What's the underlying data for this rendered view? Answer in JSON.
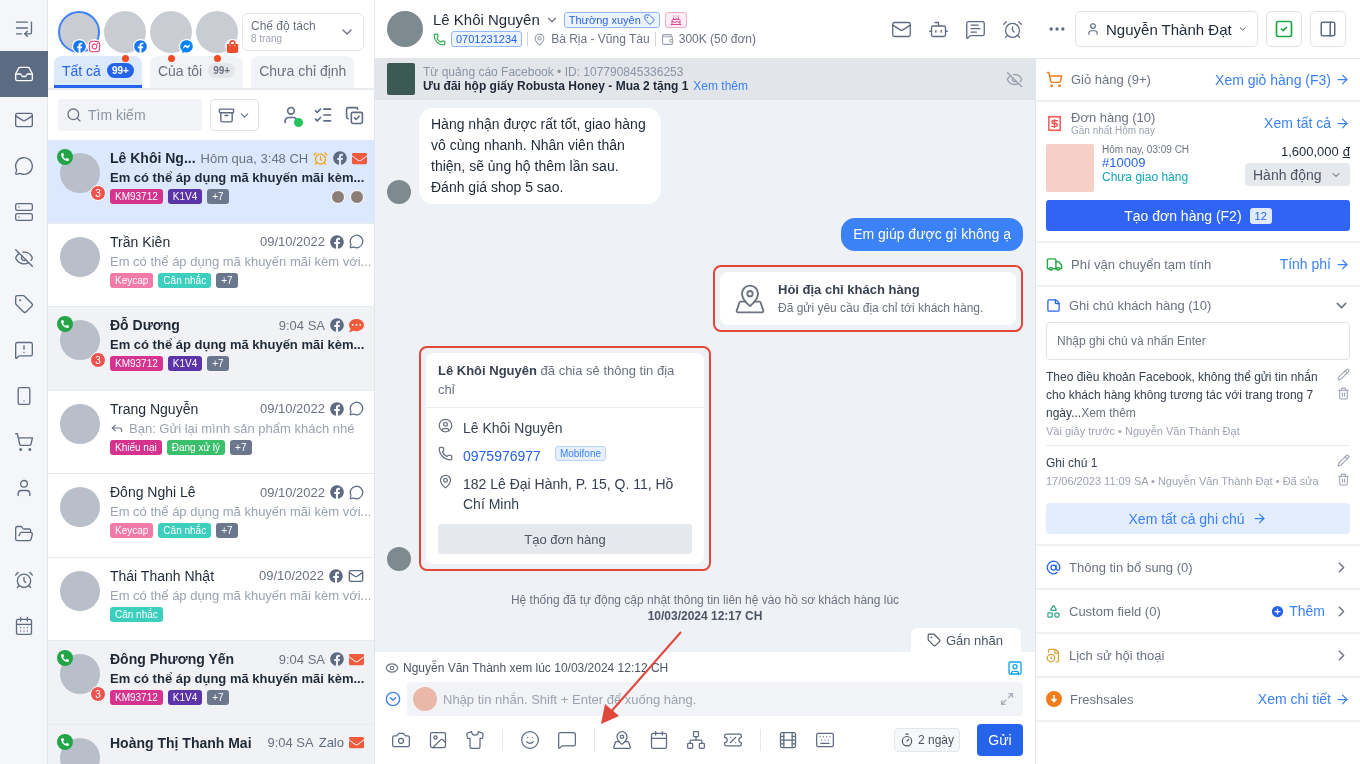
{
  "rail": {
    "items": [
      {
        "selected": false
      },
      {
        "selected": true
      },
      {
        "selected": false
      },
      {
        "selected": false
      },
      {
        "selected": false
      },
      {
        "selected": false
      },
      {
        "selected": false
      },
      {
        "selected": false
      },
      {
        "selected": false
      },
      {
        "selected": false
      },
      {
        "selected": false
      },
      {
        "selected": false
      },
      {
        "selected": false
      },
      {
        "selected": false
      }
    ]
  },
  "pages": [
    {
      "selected": true,
      "unread": false,
      "channels": [
        {
          "kind": "facebook"
        },
        {
          "kind": "instagram"
        }
      ]
    },
    {
      "selected": false,
      "unread": true,
      "channels": [
        {
          "kind": "facebook"
        }
      ]
    },
    {
      "selected": false,
      "unread": true,
      "channels": [
        {
          "kind": "messenger"
        }
      ]
    },
    {
      "selected": false,
      "unread": true,
      "channels": [
        {
          "kind": "shopee"
        }
      ]
    }
  ],
  "mode": {
    "title": "Chế độ tách",
    "subtitle": "8 trang"
  },
  "tabs": [
    {
      "label": "Tất cả",
      "count": "99+",
      "selected": true
    },
    {
      "label": "Của tôi",
      "count": "99+",
      "selected": false
    },
    {
      "label": "Chưa chỉ định",
      "selected": false
    }
  ],
  "search": {
    "placeholder": "Tìm kiếm"
  },
  "conversations": [
    {
      "name": "Lê Khôi Ng...",
      "time": "Hôm qua, 3:48 CH",
      "reminder": true,
      "source": {
        "kind": "facebook"
      },
      "status": {
        "kind": "mail",
        "alert": true
      },
      "calling": true,
      "badge": "3",
      "unread": true,
      "selected": true,
      "reply": false,
      "viewers": true,
      "preview": "Em có thể áp dụng mã khuyến mãi kèm...",
      "tags": [
        {
          "label": "KM93712",
          "color": "#d6338f"
        },
        {
          "label": "K1V4",
          "color": "#5b35a8"
        },
        {
          "label": "+7",
          "color": "#6b778c"
        }
      ]
    },
    {
      "name": "Trần Kiên",
      "time": "09/10/2022",
      "reminder": false,
      "source": {
        "kind": "facebook"
      },
      "status": {
        "kind": "chat",
        "alert": false
      },
      "calling": false,
      "unread": false,
      "selected": false,
      "reply": false,
      "viewers": false,
      "preview": "Em có thể áp dụng mã khuyến mãi kèm với...",
      "tags": [
        {
          "label": "Keycap",
          "color": "#f27aa7"
        },
        {
          "label": "Cân nhắc",
          "color": "#3ccfbd"
        },
        {
          "label": "+7",
          "color": "#6b778c"
        }
      ]
    },
    {
      "name": "Đỗ Dương",
      "time": "9:04 SA",
      "reminder": false,
      "source": {
        "kind": "facebook"
      },
      "status": {
        "kind": "chat",
        "alert": true
      },
      "calling": true,
      "badge": "3",
      "unread": true,
      "selected": false,
      "reply": false,
      "viewers": false,
      "preview": "Em có thể áp dụng mã khuyến mãi kèm...",
      "tags": [
        {
          "label": "KM93712",
          "color": "#d6338f"
        },
        {
          "label": "K1V4",
          "color": "#5b35a8"
        },
        {
          "label": "+7",
          "color": "#6b778c"
        }
      ]
    },
    {
      "name": "Trang Nguyễn",
      "time": "09/10/2022",
      "reminder": false,
      "source": {
        "kind": "facebook"
      },
      "status": {
        "kind": "chat",
        "alert": false
      },
      "calling": false,
      "unread": false,
      "selected": false,
      "reply": true,
      "viewers": false,
      "preview": "Bạn: Gửi lại mình sản phẩm khách nhé",
      "tags": [
        {
          "label": "Khiếu nại",
          "color": "#d6338f"
        },
        {
          "label": "Đang xử lý",
          "color": "#3cbf6a"
        },
        {
          "label": "+7",
          "color": "#6b778c"
        }
      ]
    },
    {
      "name": "Đông Nghi Lê",
      "time": "09/10/2022",
      "reminder": false,
      "source": {
        "kind": "facebook"
      },
      "status": {
        "kind": "chat",
        "alert": false
      },
      "calling": false,
      "unread": false,
      "selected": false,
      "reply": false,
      "viewers": false,
      "preview": "Em có thể áp dụng mã khuyến mãi kèm với...",
      "tags": [
        {
          "label": "Keycap",
          "color": "#f27aa7"
        },
        {
          "label": "Cân nhắc",
          "color": "#3ccfbd"
        },
        {
          "label": "+7",
          "color": "#6b778c"
        }
      ]
    },
    {
      "name": "Thái Thanh Nhật",
      "time": "09/10/2022",
      "reminder": false,
      "source": {
        "kind": "facebook"
      },
      "status": {
        "kind": "mail",
        "alert": false
      },
      "calling": false,
      "unread": false,
      "selected": false,
      "reply": false,
      "viewers": false,
      "preview": "Em có thể áp dụng mã khuyến mãi kèm với...",
      "tags": [
        {
          "label": "Cân nhắc",
          "color": "#3ccfbd"
        }
      ]
    },
    {
      "name": "Đông Phương Yến",
      "time": "9:04 SA",
      "reminder": false,
      "source": {
        "kind": "facebook"
      },
      "status": {
        "kind": "mail",
        "alert": true
      },
      "calling": true,
      "badge": "3",
      "unread": true,
      "selected": false,
      "reply": false,
      "viewers": false,
      "preview": "Em có thể áp dụng mã khuyến mãi kèm...",
      "tags": [
        {
          "label": "KM93712",
          "color": "#d6338f"
        },
        {
          "label": "K1V4",
          "color": "#5b35a8"
        },
        {
          "label": "+7",
          "color": "#6b778c"
        }
      ]
    },
    {
      "name": "Hoàng Thị Thanh Mai",
      "time": "9:04 SA",
      "reminder": false,
      "source": {
        "kind": "text",
        "label": "Zalo"
      },
      "status": {
        "kind": "mail",
        "alert": true
      },
      "calling": true,
      "unread": true,
      "selected": false,
      "reply": false,
      "viewers": false
    }
  ],
  "customer": {
    "name": "Lê Khôi Nguyên",
    "segment": "Thường xuyên",
    "birthday": true,
    "phone": "0701231234",
    "location": "Bà Rịa - Vũng Tàu",
    "spend": "300K (50 đơn)"
  },
  "assignee": {
    "name": "Nguyễn Thành Đạt"
  },
  "ad": {
    "source": "Từ quảng cáo Facebook • ID: 107790845336253",
    "title": "Ưu đãi hộp giấy Robusta Honey - Mua 2 tặng 1",
    "link": "Xem thêm"
  },
  "messages": [
    {
      "kind": "text",
      "outgoing": false,
      "text": "Hàng nhận được rất tốt, giao hàng vô cùng nhanh. Nhân viên thân thiện, sẽ ủng hộ thêm lần sau. Đánh giá shop 5 sao."
    },
    {
      "kind": "text",
      "outgoing": true,
      "text": "Em giúp được gì không ạ"
    },
    {
      "kind": "address-request",
      "outgoing": true,
      "highlighted": true,
      "title": "Hỏi địa chỉ khách hàng",
      "text": "Đã gửi yêu cầu địa chỉ tới khách hàng."
    },
    {
      "kind": "address-share",
      "outgoing": false,
      "highlighted": true,
      "title": "**Lê Khôi Nguyên** đã chia sẻ thông tin địa chỉ",
      "name": "Lê Khôi Nguyên",
      "phone": "0975976977",
      "carrier": "Mobifone",
      "address": "182 Lê Đại Hành, P. 15, Q. 11, Hồ Chí Minh",
      "button": "Tạo đơn hàng"
    },
    {
      "kind": "system",
      "text": "Hệ thống đã tự động cập nhật thông tin liên hệ vào hồ sơ khách hàng lúc",
      "time": "10/03/2024 12:17 CH"
    }
  ],
  "label_button": "Gắn nhãn",
  "seen": "Nguyễn Văn Thành xem lúc 10/03/2024 12:12 CH",
  "composer": {
    "placeholder": "Nhập tin nhắn. Shift + Enter để xuống hàng.",
    "timer": "2 ngày",
    "send": "Gửi"
  },
  "cart": {
    "title": "Giỏ hàng (9+)",
    "link": "Xem giỏ hàng (F3)"
  },
  "orders": {
    "title": "Đơn hàng (10)",
    "subtitle": "Gần nhất Hôm nay",
    "link": "Xem tất cả",
    "order": {
      "time": "Hôm nay, 03:09 CH",
      "code": "#10009",
      "status": "Chưa giao hàng",
      "amount": "1,600,000",
      "currency": "đ",
      "action": "Hành động"
    },
    "create": "Tạo đơn hàng (F2)",
    "create_count": "12"
  },
  "shipping": {
    "title": "Phí vận chuyển tạm tính",
    "link": "Tính phí"
  },
  "notes": {
    "title": "Ghi chú khách hàng (10)",
    "expanded": true,
    "placeholder": "Nhập ghi chú và nhấn Enter",
    "items": [
      {
        "text": "Theo điều khoản Facebook, không thể gửi tin nhắn cho khách hàng không tương tác với trang trong 7 ngày...",
        "more": "Xem thêm",
        "meta": "Vài giây trước • Nguyễn Văn Thành Đạt"
      },
      {
        "text": "Ghi chú 1",
        "meta": "17/06/2023 11:09 SA • Nguyễn Văn Thành Đạt • Đã sửa"
      }
    ],
    "all": "Xem tất cả ghi chú"
  },
  "sections": [
    {
      "kind": "extra",
      "title": "Thông tin bổ sung (0)"
    },
    {
      "kind": "custom",
      "title": "Custom field (0)",
      "action": "Thêm"
    },
    {
      "kind": "history",
      "title": "Lịch sử hội thoại"
    },
    {
      "kind": "crm",
      "title": "Freshsales",
      "link": "Xem chi tiết"
    }
  ]
}
